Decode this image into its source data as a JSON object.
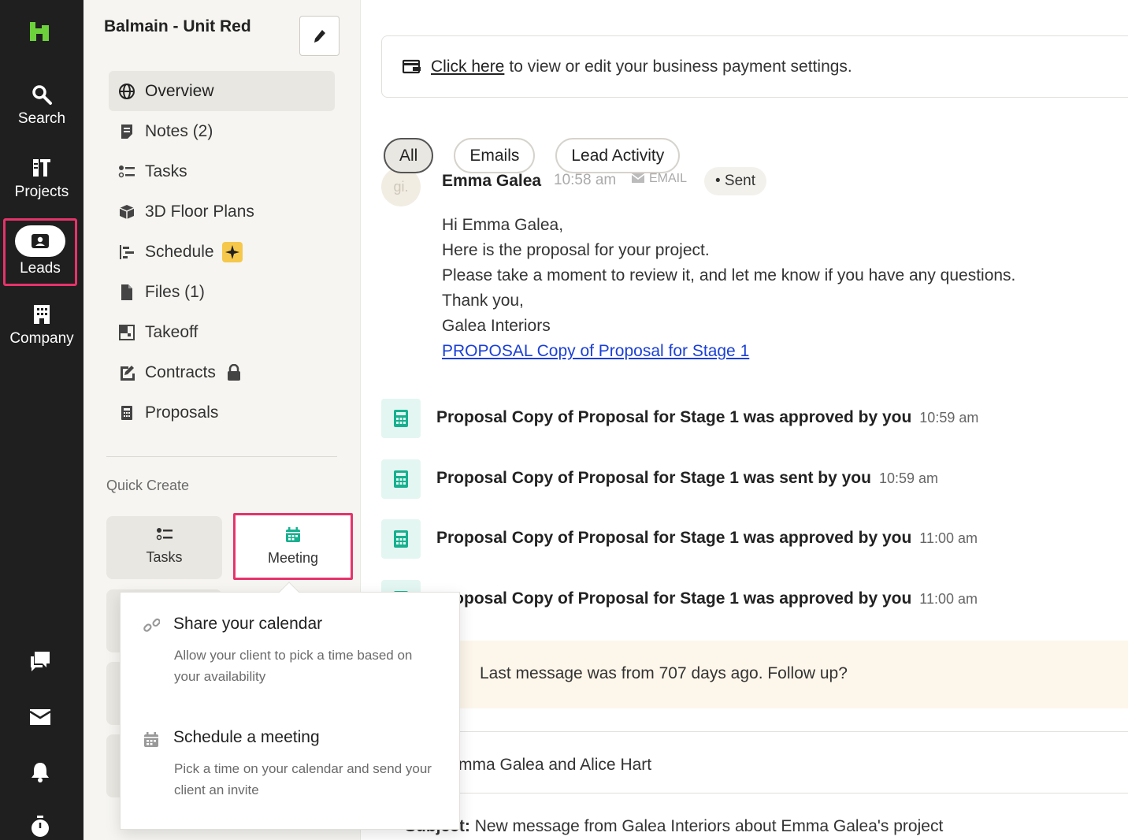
{
  "rail": {
    "items": [
      {
        "label": "Search",
        "icon": "search-icon"
      },
      {
        "label": "Projects",
        "icon": "projects-icon"
      },
      {
        "label": "Leads",
        "icon": "leads-icon"
      },
      {
        "label": "Company",
        "icon": "company-icon"
      }
    ],
    "bottom_icons": [
      "messages-icon",
      "inbox-icon",
      "bell-icon",
      "timer-icon"
    ],
    "brand_color": "#6dd13c",
    "highlight_color": "#e6336b"
  },
  "sidebar": {
    "title": "Balmain - Unit Red",
    "nav": [
      {
        "label": "Overview",
        "icon": "globe-icon"
      },
      {
        "label": "Notes (2)",
        "icon": "notes-icon"
      },
      {
        "label": "Tasks",
        "icon": "tasks-icon"
      },
      {
        "label": "3D Floor Plans",
        "icon": "cube-icon"
      },
      {
        "label": "Schedule",
        "icon": "schedule-icon"
      },
      {
        "label": "Files (1)",
        "icon": "file-icon"
      },
      {
        "label": "Takeoff",
        "icon": "takeoff-icon"
      },
      {
        "label": "Contracts",
        "icon": "contracts-icon"
      },
      {
        "label": "Proposals",
        "icon": "proposals-icon"
      }
    ],
    "quick_create_label": "Quick Create",
    "quick_create": [
      {
        "label": "Tasks",
        "icon": "tasks-icon"
      },
      {
        "label": "Meeting",
        "icon": "calendar-icon"
      }
    ]
  },
  "dropdown": {
    "options": [
      {
        "title": "Share your calendar",
        "desc": "Allow your client to pick a time based on your availability",
        "icon": "link-icon"
      },
      {
        "title": "Schedule a meeting",
        "desc": "Pick a time on your calendar and send your client an invite",
        "icon": "calendar-icon"
      }
    ]
  },
  "main": {
    "banner": {
      "link": "Click here",
      "text": "to view or edit your business payment settings."
    },
    "filters": [
      "All",
      "Emails",
      "Lead Activity"
    ],
    "email": {
      "avatar": "gi.",
      "from": "Emma Galea",
      "time": "10:58 am",
      "type": "EMAIL",
      "status": "• Sent",
      "lines": [
        "Hi Emma Galea,",
        "Here is the proposal for your project.",
        "Please take a moment to review it, and let me know if you have any questions.",
        "Thank you,",
        "Galea Interiors"
      ],
      "link": "PROPOSAL Copy of Proposal for Stage 1"
    },
    "activities": [
      {
        "text": "Proposal Copy of Proposal for Stage 1 was approved by you",
        "time": "10:59 am"
      },
      {
        "text": "Proposal Copy of Proposal for Stage 1 was sent by you",
        "time": "10:59 am"
      },
      {
        "text": "Proposal Copy of Proposal for Stage 1 was approved by you",
        "time": "11:00 am"
      },
      {
        "text": "Proposal Copy of Proposal for Stage 1 was approved by you",
        "time": "11:00 am"
      }
    ],
    "followup": "Last message was from 707 days ago. Follow up?",
    "thread_participants": "Emma Galea and Alice Hart",
    "thread_subject_label": "Subject:",
    "thread_subject": "New message from Galea Interiors about Emma Galea's project",
    "accent_teal": "#17b08f",
    "link_color": "#1a3fd6"
  }
}
